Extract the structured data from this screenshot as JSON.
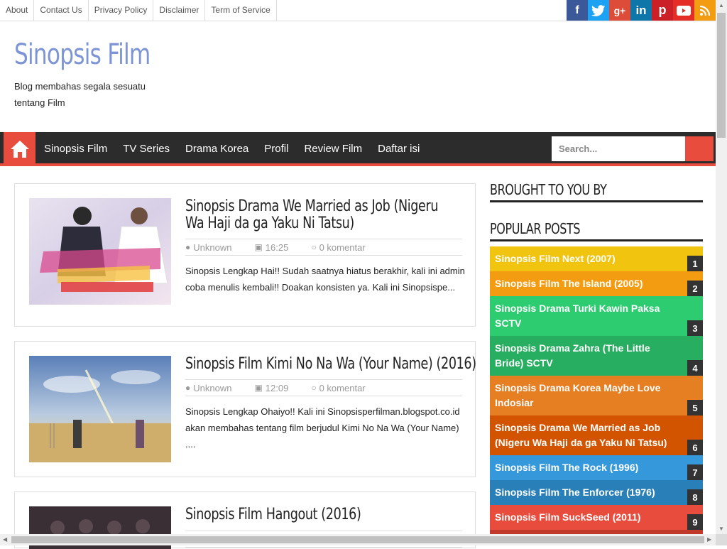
{
  "top_links": [
    "About",
    "Contact Us",
    "Privacy Policy",
    "Disclaimer",
    "Term of Service"
  ],
  "socials": [
    {
      "name": "facebook-icon",
      "glyph": "f",
      "color": "#3b5998"
    },
    {
      "name": "twitter-icon",
      "glyph": "t",
      "color": "#1da1f2"
    },
    {
      "name": "google-plus-icon",
      "glyph": "g+",
      "color": "#dd4b39"
    },
    {
      "name": "linkedin-icon",
      "glyph": "in",
      "color": "#0e76a8"
    },
    {
      "name": "pinterest-icon",
      "glyph": "p",
      "color": "#cb2027"
    },
    {
      "name": "youtube-icon",
      "glyph": "▶",
      "color": "#e52d27"
    },
    {
      "name": "rss-icon",
      "glyph": "))",
      "color": "#f39c12"
    }
  ],
  "site": {
    "title": "Sinopsis Film",
    "description": "Blog membahas segala sesuatu tentang Film"
  },
  "nav": {
    "items": [
      "Sinopsis Film",
      "TV Series",
      "Drama Korea",
      "Profil",
      "Review Film",
      "Daftar isi"
    ],
    "search_placeholder": "Search..."
  },
  "posts": [
    {
      "title": "Sinopsis Drama We Married as Job (Nigeru Wa Haji da ga Yaku Ni Tatsu)",
      "author": "Unknown",
      "time": "16:25",
      "comments": "0 komentar",
      "excerpt": "Sinopsis Lengkap Hai!! Sudah saatnya hiatus berakhir, kali ini admin coba menulis kembali!! Doakan konsisten ya. Kali ini Sinopsispe..."
    },
    {
      "title": "Sinopsis Film Kimi No Na Wa (Your Name) (2016)",
      "author": "Unknown",
      "time": "12:09",
      "comments": "0 komentar",
      "excerpt": "Sinopsis Lengkap Ohaiyo!! Kali ini Sinopsisperfilman.blogspot.co.id akan membahas tentang film berjudul Kimi No Na Wa (Your Name) ...."
    },
    {
      "title": "Sinopsis Film Hangout (2016)",
      "author": "",
      "time": "",
      "comments": "",
      "excerpt": ""
    }
  ],
  "sidebar": {
    "brought_title": "BROUGHT TO YOU BY",
    "popular_title": "POPULAR POSTS",
    "popular": [
      {
        "title": "Sinopsis Film Next (2007)",
        "num": "1",
        "color": "#f1c40f"
      },
      {
        "title": "Sinopsis Film The Island (2005)",
        "num": "2",
        "color": "#f39c12"
      },
      {
        "title": "Sinopsis Drama Turki Kawin Paksa SCTV",
        "num": "3",
        "color": "#2ecc71"
      },
      {
        "title": "Sinopsis Drama Zahra (The Little Bride) SCTV",
        "num": "4",
        "color": "#27ae60"
      },
      {
        "title": "Sinopsis Drama Korea Maybe Love Indosiar",
        "num": "5",
        "color": "#e67e22"
      },
      {
        "title": "Sinopsis Drama We Married as Job (Nigeru Wa Haji da ga Yaku Ni Tatsu)",
        "num": "6",
        "color": "#d35400"
      },
      {
        "title": "Sinopsis Film The Rock (1996)",
        "num": "7",
        "color": "#3498db"
      },
      {
        "title": "Sinopsis Film The Enforcer (1976)",
        "num": "8",
        "color": "#2980b9"
      },
      {
        "title": "Sinopsis Film SuckSeed (2011)",
        "num": "9",
        "color": "#e74c3c"
      }
    ]
  }
}
